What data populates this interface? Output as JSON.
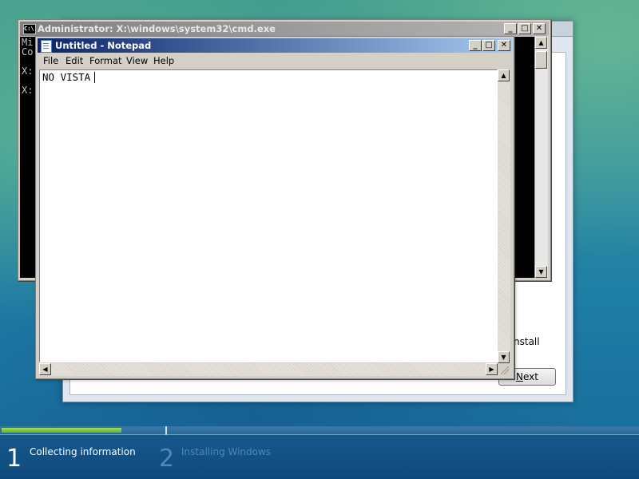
{
  "setup_window": {
    "install_text": "nstall",
    "next_button": "Next",
    "next_accel_char": "N"
  },
  "cmd_window": {
    "title": "Administrator: X:\\windows\\system32\\cmd.exe",
    "icon_text": "C:\\",
    "lines": [
      "Mi",
      "Co",
      "",
      "X:",
      "",
      "X:"
    ],
    "buttons": {
      "minimize": "_",
      "maximize": "□",
      "close": "✕"
    }
  },
  "notepad": {
    "title": "Untitled - Notepad",
    "menu": [
      "File",
      "Edit",
      "Format",
      "View",
      "Help"
    ],
    "content": "NO VISTA",
    "buttons": {
      "minimize": "_",
      "maximize": "□",
      "close": "✕"
    }
  },
  "setup_progress": {
    "steps": [
      {
        "number": "1",
        "label": "Collecting information",
        "active": true
      },
      {
        "number": "2",
        "label": "Installing Windows",
        "active": false
      }
    ]
  },
  "colors": {
    "notepad_title_start": "#0a246a",
    "notepad_title_end": "#a6caf0",
    "cmd_background": "#000000",
    "progress_fill": "#5fb02c"
  }
}
